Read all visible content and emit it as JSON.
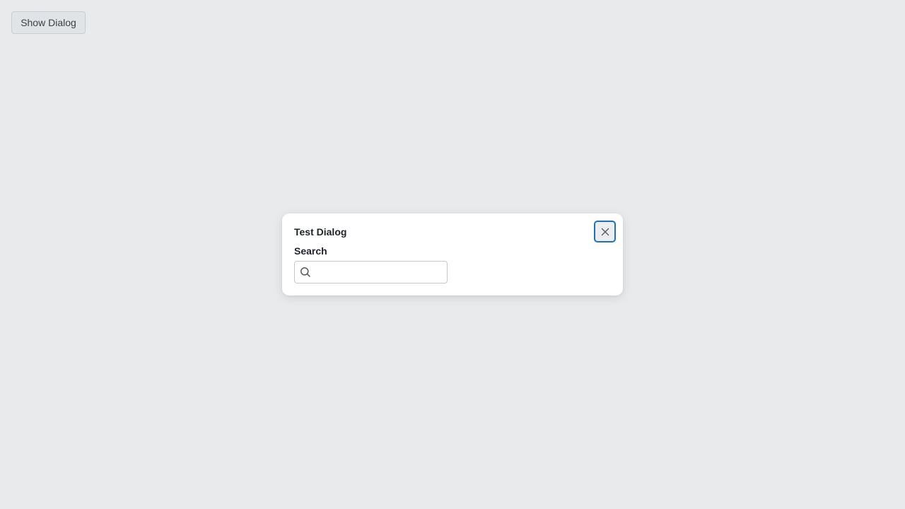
{
  "page": {
    "background": "#e9eaec",
    "show_dialog_label": "Show Dialog"
  },
  "dialog": {
    "title": "Test Dialog",
    "close_icon": "close-icon",
    "focus_color": "#1f6fbf",
    "search": {
      "label": "Search",
      "icon": "search-icon",
      "value": "",
      "placeholder": ""
    }
  }
}
